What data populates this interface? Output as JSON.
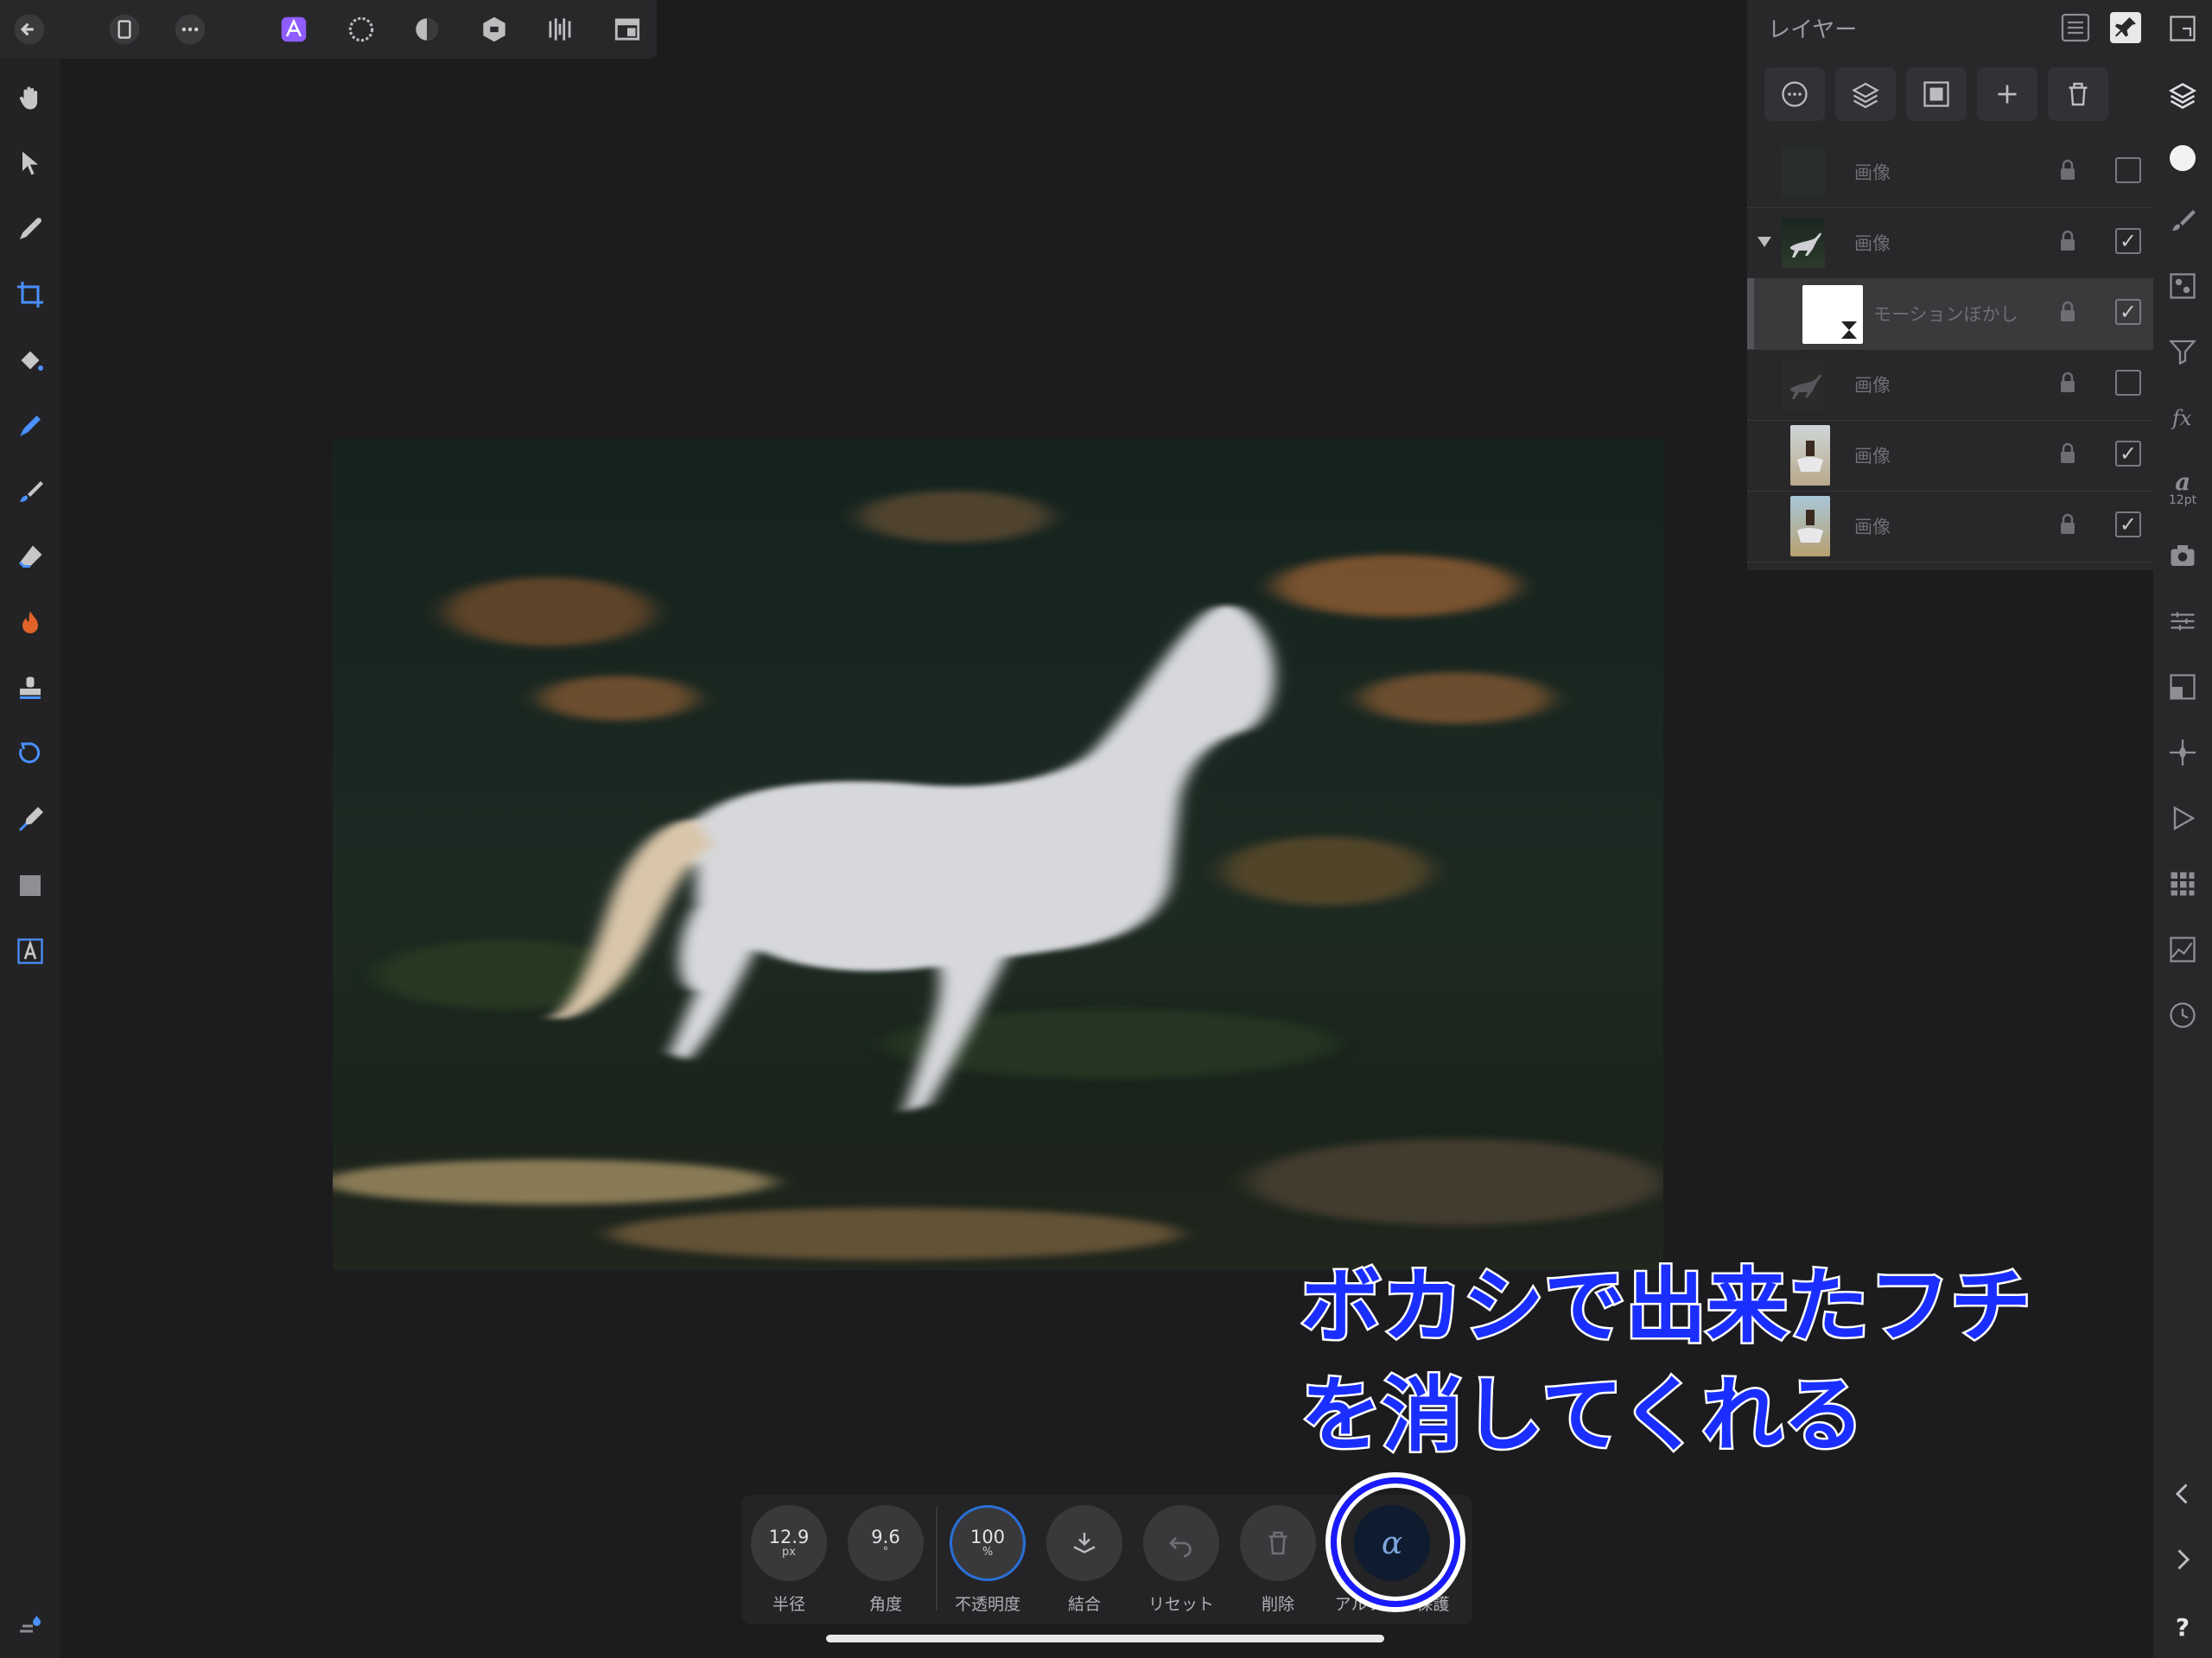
{
  "top_toolbar": {
    "buttons": [
      "back-icon",
      "document-icon",
      "more-icon",
      "photo-persona-icon",
      "liquify-persona-icon",
      "develop-persona-icon",
      "tone-mapping-persona-icon",
      "export-persona-icon",
      "view-icon"
    ]
  },
  "left_tools": [
    "hand-tool",
    "move-tool",
    "color-picker-tool",
    "crop-tool",
    "flood-fill-tool",
    "selection-brush-tool",
    "paint-brush-tool",
    "eraser-tool",
    "dodge-burn-tool",
    "clone-tool",
    "healing-tool",
    "pen-tool",
    "rectangle-tool",
    "text-tool"
  ],
  "layers_panel": {
    "title": "レイヤー",
    "layers": [
      {
        "name": "画像",
        "checked": false,
        "selected": false
      },
      {
        "name": "画像",
        "checked": true,
        "selected": false,
        "expanded": true
      },
      {
        "name": "モーションぼかし",
        "checked": true,
        "selected": true,
        "child": true
      },
      {
        "name": "画像",
        "checked": false,
        "selected": false
      },
      {
        "name": "画像",
        "checked": true,
        "selected": false
      },
      {
        "name": "画像",
        "checked": true,
        "selected": false
      }
    ],
    "check_mark": "✓"
  },
  "context_toolbar": {
    "radius": {
      "value": "12.9",
      "unit": "px",
      "label": "半径"
    },
    "angle": {
      "value": "9.6",
      "unit": "°",
      "label": "角度"
    },
    "opacity": {
      "value": "100",
      "unit": "%",
      "label": "不透明度"
    },
    "merge": {
      "label": "結合"
    },
    "reset": {
      "label": "リセット"
    },
    "delete": {
      "label": "削除"
    },
    "alpha_protect": {
      "symbol": "α",
      "label": "アルファの保護"
    }
  },
  "annotation": {
    "line1": "ボカシで出来たフチ",
    "line2": "を消してくれる",
    "color": "#1a2fff"
  },
  "right_rail": {
    "font_size_label": "12pt",
    "help": "?"
  },
  "colors": {
    "accent": "#8e5cff",
    "panel": "#28282b",
    "background": "#1c1c1e"
  }
}
